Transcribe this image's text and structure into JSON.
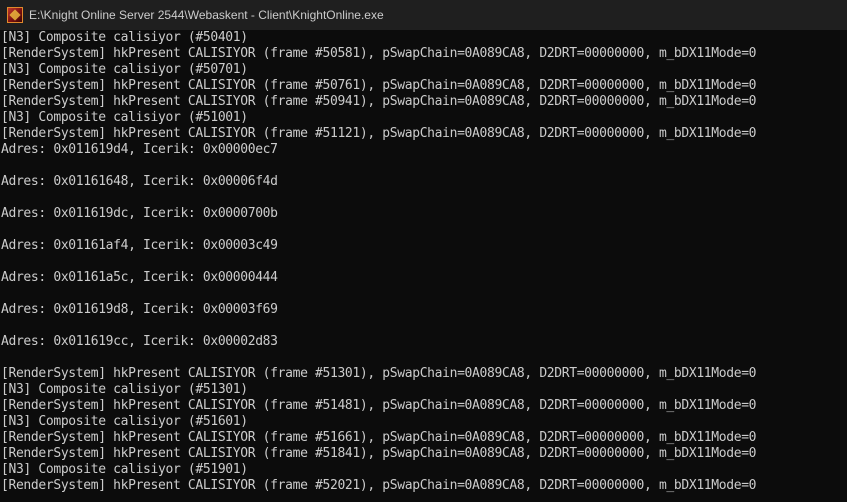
{
  "window": {
    "title": "E:\\Knight Online Server 2544\\Webaskent - Client\\KnightOnline.exe",
    "icon": "knight-online-app-icon"
  },
  "console": {
    "text_color": "#cccccc",
    "background": "#0c0c0c",
    "lines": [
      "[N3] Composite calisiyor (#50401)",
      "[RenderSystem] hkPresent CALISIYOR (frame #50581), pSwapChain=0A089CA8, D2DRT=00000000, m_bDX11Mode=0",
      "[N3] Composite calisiyor (#50701)",
      "[RenderSystem] hkPresent CALISIYOR (frame #50761), pSwapChain=0A089CA8, D2DRT=00000000, m_bDX11Mode=0",
      "[RenderSystem] hkPresent CALISIYOR (frame #50941), pSwapChain=0A089CA8, D2DRT=00000000, m_bDX11Mode=0",
      "[N3] Composite calisiyor (#51001)",
      "[RenderSystem] hkPresent CALISIYOR (frame #51121), pSwapChain=0A089CA8, D2DRT=00000000, m_bDX11Mode=0",
      "Adres: 0x011619d4, Icerik: 0x00000ec7",
      "",
      "Adres: 0x01161648, Icerik: 0x00006f4d",
      "",
      "Adres: 0x011619dc, Icerik: 0x0000700b",
      "",
      "Adres: 0x01161af4, Icerik: 0x00003c49",
      "",
      "Adres: 0x01161a5c, Icerik: 0x00000444",
      "",
      "Adres: 0x011619d8, Icerik: 0x00003f69",
      "",
      "Adres: 0x011619cc, Icerik: 0x00002d83",
      "",
      "[RenderSystem] hkPresent CALISIYOR (frame #51301), pSwapChain=0A089CA8, D2DRT=00000000, m_bDX11Mode=0",
      "[N3] Composite calisiyor (#51301)",
      "[RenderSystem] hkPresent CALISIYOR (frame #51481), pSwapChain=0A089CA8, D2DRT=00000000, m_bDX11Mode=0",
      "[N3] Composite calisiyor (#51601)",
      "[RenderSystem] hkPresent CALISIYOR (frame #51661), pSwapChain=0A089CA8, D2DRT=00000000, m_bDX11Mode=0",
      "[RenderSystem] hkPresent CALISIYOR (frame #51841), pSwapChain=0A089CA8, D2DRT=00000000, m_bDX11Mode=0",
      "[N3] Composite calisiyor (#51901)",
      "[RenderSystem] hkPresent CALISIYOR (frame #52021), pSwapChain=0A089CA8, D2DRT=00000000, m_bDX11Mode=0"
    ]
  }
}
